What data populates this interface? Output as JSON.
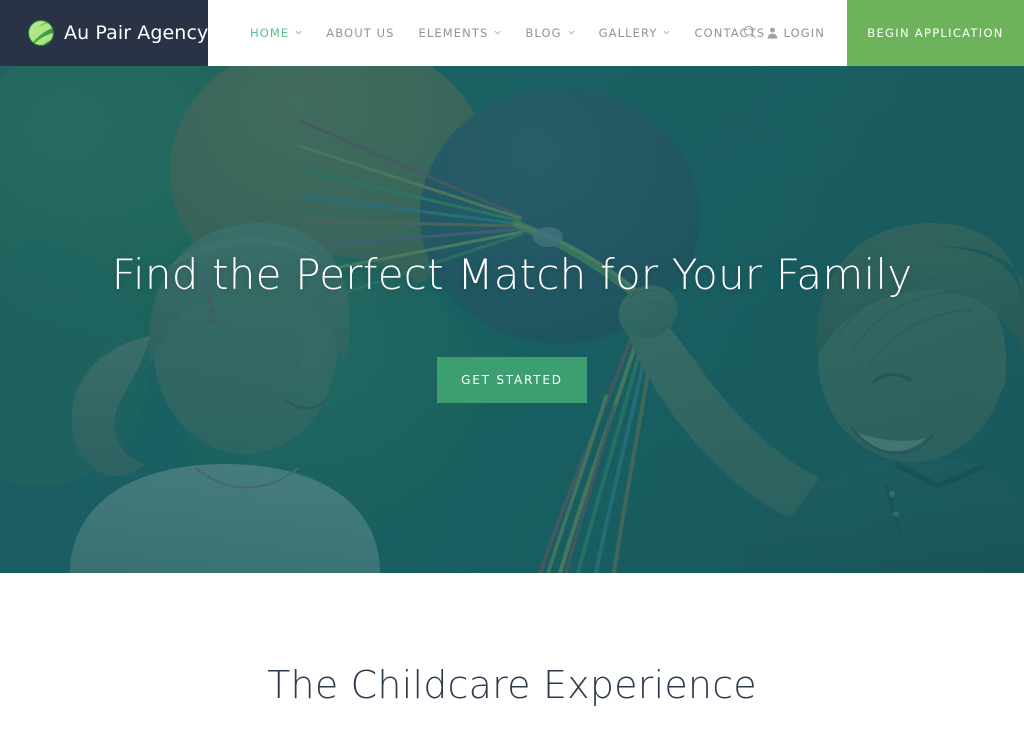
{
  "site": {
    "brand_name": "Au Pair Agency",
    "logo_icon": "striped-sphere-icon",
    "colors": {
      "header_dark": "#2a3246",
      "accent_green": "#6cb35c",
      "active_nav_green": "#5cc08d",
      "hero_teal": "#1f5f62",
      "heading_navy": "#2e3a4d",
      "nav_text_gray": "#8c949e"
    }
  },
  "header": {
    "nav": [
      {
        "label": "HOME",
        "has_dropdown": true,
        "active": true
      },
      {
        "label": "ABOUT US",
        "has_dropdown": false,
        "active": false
      },
      {
        "label": "ELEMENTS",
        "has_dropdown": true,
        "active": false
      },
      {
        "label": "BLOG",
        "has_dropdown": true,
        "active": false
      },
      {
        "label": "GALLERY",
        "has_dropdown": true,
        "active": false
      },
      {
        "label": "CONTACTS",
        "has_dropdown": false,
        "active": false
      }
    ],
    "search_icon": "search-icon",
    "login_icon": "user-icon",
    "login_label": "LOGIN",
    "apply_label": "BEGIN APPLICATION"
  },
  "hero": {
    "title": "Find the Perfect Match for Your Family",
    "cta_label": "GET STARTED",
    "image_alt": "Two children outdoors holding colorful balloons"
  },
  "section": {
    "title": "The Childcare Experience"
  }
}
